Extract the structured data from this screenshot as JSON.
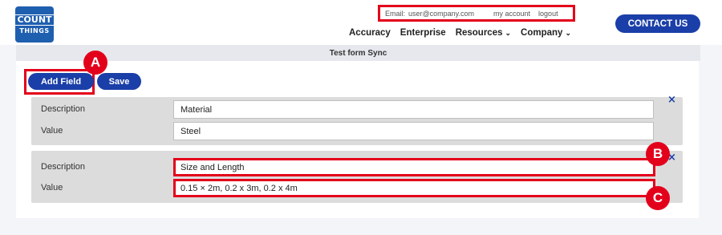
{
  "logo": {
    "line1": "COUNT",
    "line2": "THINGS"
  },
  "account_bar": {
    "email_label": "Email:",
    "email_value": "user@company.com",
    "my_account": "my account",
    "logout": "logout"
  },
  "nav": {
    "items": [
      {
        "label": "Accuracy",
        "has_dropdown": false
      },
      {
        "label": "Enterprise",
        "has_dropdown": false
      },
      {
        "label": "Resources",
        "has_dropdown": true
      },
      {
        "label": "Company",
        "has_dropdown": true
      }
    ]
  },
  "contact_label": "CONTACT US",
  "page": {
    "title": "Test form Sync"
  },
  "toolbar": {
    "add_field_label": "Add Field",
    "save_label": "Save"
  },
  "fields": [
    {
      "description_label": "Description",
      "description_value": "Material",
      "value_label": "Value",
      "value_value": "Steel"
    },
    {
      "description_label": "Description",
      "description_value": "Size and Length",
      "value_label": "Value",
      "value_value": "0.15 × 2m, 0.2 x 3m, 0.2 x 4m"
    }
  ],
  "close_glyph": "×",
  "chevron_glyph": "⌄",
  "annotations": {
    "a": "A",
    "b": "B",
    "c": "C"
  },
  "colors": {
    "accent": "#1b3fa8",
    "highlight": "#e3001b"
  }
}
